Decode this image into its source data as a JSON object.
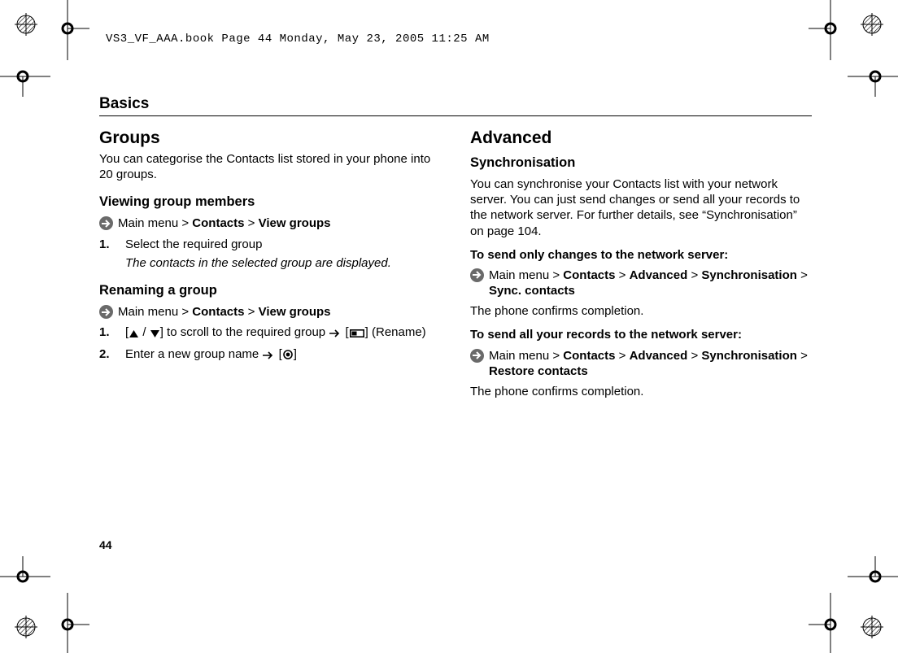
{
  "header": "VS3_VF_AAA.book  Page 44  Monday, May 23, 2005  11:25 AM",
  "chapter": "Basics",
  "pagenum": "44",
  "left": {
    "h_groups": "Groups",
    "p_groups": "You can categorise the Contacts list stored in your phone into 20 groups.",
    "h_viewmembers": "Viewing group members",
    "crumb_view": {
      "pre": "Main menu > ",
      "a": "Contacts",
      "sep": " > ",
      "b": "View groups"
    },
    "step_view_1": "Select the required group",
    "step_view_1_sub": "The contacts in the selected group are displayed.",
    "h_rename": "Renaming a group",
    "crumb_rename": {
      "pre": "Main menu > ",
      "a": "Contacts",
      "sep": " > ",
      "b": "View groups"
    },
    "step_rename_1_a": "[",
    "step_rename_1_b": " / ",
    "step_rename_1_c": "] to scroll to the required group ",
    "step_rename_1_d": " [",
    "step_rename_1_e": "] (Rename)",
    "step_rename_2_a": "Enter a new group name ",
    "step_rename_2_b": " [",
    "step_rename_2_c": "]"
  },
  "right": {
    "h_adv": "Advanced",
    "h_sync": "Synchronisation",
    "p_sync": "You can synchronise your Contacts list with your network server. You can just send changes or send all your records to the network server. For further details, see “Synchronisation” on page 104.",
    "h_sendchanges": "To send only changes to the network server:",
    "crumb_sync1": {
      "pre": "Main menu > ",
      "a": "Contacts",
      "s1": " > ",
      "b": "Advanced",
      "s2": " > ",
      "c": "Synchronisation",
      "s3": " > ",
      "d": "Sync. contacts"
    },
    "p_confirm1": "The phone confirms completion.",
    "h_sendall": "To send all your records to the network server:",
    "crumb_sync2": {
      "pre": "Main menu > ",
      "a": "Contacts",
      "s1": " > ",
      "b": "Advanced",
      "s2": " > ",
      "c": "Synchronisation",
      "s3": " > ",
      "d": "Restore contacts"
    },
    "p_confirm2": "The phone confirms completion."
  }
}
